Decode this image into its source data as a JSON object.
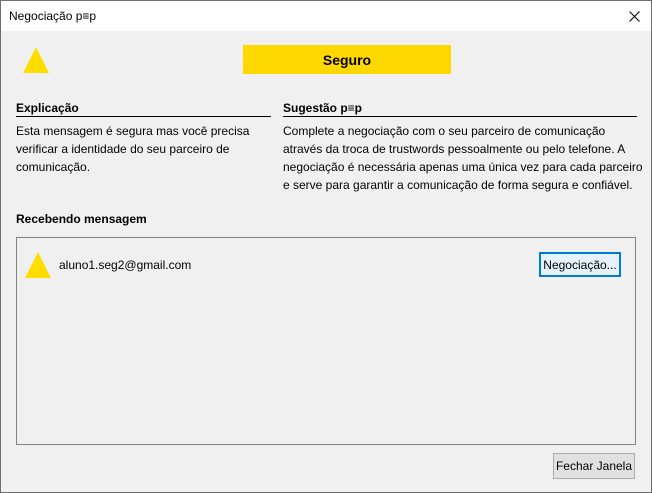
{
  "window": {
    "title": "Negociação p≡p",
    "close_icon": "close-icon"
  },
  "rating": {
    "label": "Seguro",
    "color": "#ffd800",
    "icon": "warning-triangle-icon"
  },
  "explanation": {
    "heading": "Explicação",
    "text": "Esta mensagem é segura mas você precisa verificar a identidade do seu parceiro de comunicação."
  },
  "suggestion": {
    "heading": "Sugestão p≡p",
    "text": "Complete a negociação com o seu parceiro de comunicação através da troca de trustwords pessoalmente ou pelo telefone. A negociação é necessária apenas uma única vez para cada parceiro e serve para garantir a comunicação de forma segura e confiável."
  },
  "receiving": {
    "heading": "Recebendo mensagem",
    "contacts": [
      {
        "email": "aluno1.seg2@gmail.com",
        "icon": "warning-triangle-icon",
        "button_label": "Negociação..."
      }
    ]
  },
  "footer": {
    "close_label": "Fechar Janela"
  }
}
